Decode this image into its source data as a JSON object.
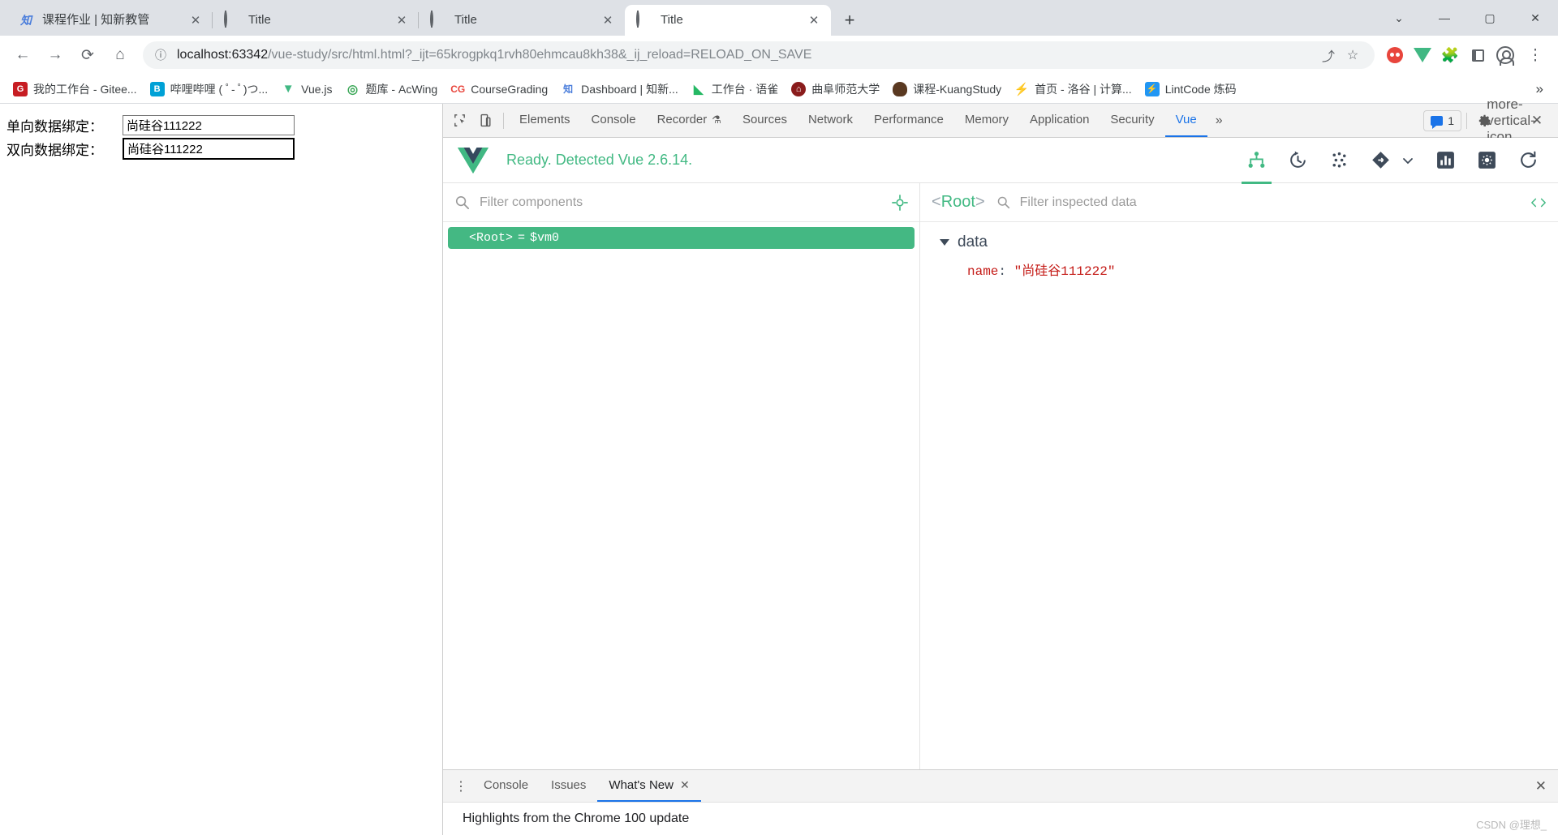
{
  "browser": {
    "tabs": [
      {
        "title": "课程作业 | 知新教管",
        "favicon": "zhixin-icon",
        "active": false
      },
      {
        "title": "Title",
        "favicon": "globe-icon",
        "active": false
      },
      {
        "title": "Title",
        "favicon": "globe-icon",
        "active": false
      },
      {
        "title": "Title",
        "favicon": "globe-icon",
        "active": true
      }
    ],
    "new_tab_label": "+",
    "window_controls": {
      "minimize": "—",
      "maximize": "▢",
      "close": "✕",
      "chevron": "⌄"
    },
    "toolbar": {
      "back": "←",
      "forward": "→",
      "reload": "⟳",
      "home": "⌂",
      "site_info_icon": "info-circle-icon",
      "url_host": "localhost:63342",
      "url_path": "/vue-study/src/html.html?_ijt=65krogpkq1rvh80ehmcau8kh38&_ij_reload=RELOAD_ON_SAVE",
      "share_icon": "share-icon",
      "bookmark_icon": "star-icon"
    },
    "bookmarks": [
      {
        "label": "我的工作台 - Gitee...",
        "icon": "gitee-icon",
        "color": "#c71d23"
      },
      {
        "label": "哔哩哔哩 ( ﾟ- ﾟ)つ...",
        "icon": "bilibili-icon",
        "color": "#00a1d6"
      },
      {
        "label": "Vue.js",
        "icon": "vue-icon",
        "color": "#41b883"
      },
      {
        "label": "题库 - AcWing",
        "icon": "acwing-icon",
        "color": "#3aa757"
      },
      {
        "label": "CourseGrading",
        "icon": "coursegrading-icon",
        "color": "#e8453c"
      },
      {
        "label": "Dashboard | 知新...",
        "icon": "zhixin-icon",
        "color": "#4a7ddb"
      },
      {
        "label": "工作台 · 语雀",
        "icon": "yuque-icon",
        "color": "#25b864"
      },
      {
        "label": "曲阜师范大学",
        "icon": "qfnu-icon",
        "color": "#8a1c1c"
      },
      {
        "label": "课程-KuangStudy",
        "icon": "kuangstudy-icon",
        "color": "#5a3921"
      },
      {
        "label": "首页 - 洛谷 | 计算...",
        "icon": "luogu-icon",
        "color": "#3498db"
      },
      {
        "label": "LintCode 炼码",
        "icon": "lintcode-icon",
        "color": "#2196f3"
      }
    ],
    "bookmarks_overflow": "»"
  },
  "page": {
    "rows": [
      {
        "label": "单向数据绑定：",
        "value": "尚硅谷111222",
        "focused": false
      },
      {
        "label": "双向数据绑定：",
        "value": "尚硅谷111222",
        "focused": true
      }
    ]
  },
  "devtools": {
    "inspect_icon": "inspect-element-icon",
    "device_icon": "device-toolbar-icon",
    "tabs": [
      {
        "label": "Elements",
        "active": false
      },
      {
        "label": "Console",
        "active": false
      },
      {
        "label": "Recorder",
        "active": false,
        "badge": "flask-icon"
      },
      {
        "label": "Sources",
        "active": false
      },
      {
        "label": "Network",
        "active": false
      },
      {
        "label": "Performance",
        "active": false
      },
      {
        "label": "Memory",
        "active": false
      },
      {
        "label": "Application",
        "active": false
      },
      {
        "label": "Security",
        "active": false
      },
      {
        "label": "Vue",
        "active": true
      }
    ],
    "more_tabs": "»",
    "issues_count": "1",
    "settings_icon": "gear-icon",
    "kebab_icon": "more-vertical-icon",
    "close_icon": "close-icon"
  },
  "vue": {
    "status": "Ready. Detected Vue 2.6.14.",
    "logo": "vue-logo-icon",
    "actions": [
      {
        "name": "components-tab-icon",
        "active": true
      },
      {
        "name": "timeline-history-icon",
        "active": false
      },
      {
        "name": "vuex-dots-icon",
        "active": false
      },
      {
        "name": "routes-icon",
        "active": false
      },
      {
        "name": "performance-bars-icon",
        "active": false
      },
      {
        "name": "vue-settings-icon",
        "active": false
      },
      {
        "name": "refresh-icon",
        "active": false
      }
    ],
    "tree": {
      "filter_placeholder": "Filter components",
      "filter_value": "",
      "select-target-icon": "target-icon",
      "nodes": [
        {
          "tag": "<Root>",
          "eq": "=",
          "ref": "$vm0",
          "selected": true
        }
      ]
    },
    "inspector": {
      "root_label": "<Root>",
      "filter_placeholder": "Filter inspected data",
      "filter_value": "",
      "code_icon": "angle-brackets-icon",
      "groups": [
        {
          "title": "data",
          "expanded": true,
          "entries": [
            {
              "key": "name",
              "sep": ":",
              "value": "\"尚硅谷111222\""
            }
          ]
        }
      ]
    }
  },
  "drawer": {
    "kebab": "⋮",
    "tabs": [
      {
        "label": "Console",
        "active": false,
        "closable": false
      },
      {
        "label": "Issues",
        "active": false,
        "closable": false
      },
      {
        "label": "What's New",
        "active": true,
        "closable": true
      }
    ],
    "close_label": "✕",
    "drawer_close": "✕",
    "content": "Highlights from the Chrome 100 update",
    "watermark": "CSDN @理想_"
  }
}
